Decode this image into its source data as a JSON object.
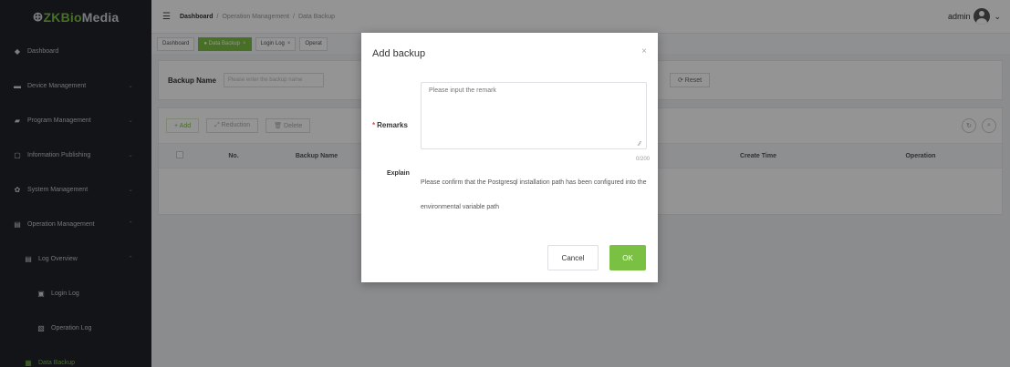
{
  "logo": {
    "mark": "⊕",
    "brand": "ZKBio",
    "suffix": "Media"
  },
  "sidebar": {
    "items": [
      {
        "label": "Dashboard",
        "icon": "dashboard-icon",
        "glyph": "◆"
      },
      {
        "label": "Device Management",
        "icon": "device-icon",
        "glyph": "▬",
        "chevron": "⌄"
      },
      {
        "label": "Program Management",
        "icon": "program-icon",
        "glyph": "▰",
        "chevron": "⌄"
      },
      {
        "label": "Information Publishing",
        "icon": "publish-icon",
        "glyph": "▢",
        "chevron": "⌄"
      },
      {
        "label": "System Management",
        "icon": "system-gear-icon",
        "glyph": "✿",
        "chevron": "⌄"
      },
      {
        "label": "Operation Management",
        "icon": "operation-icon",
        "glyph": "▤",
        "chevron": "⌃"
      },
      {
        "label": "Log Overview",
        "icon": "log-overview-icon",
        "glyph": "▤",
        "chevron": "⌃"
      },
      {
        "label": "Login Log",
        "icon": "login-log-icon",
        "glyph": "▣"
      },
      {
        "label": "Operation Log",
        "icon": "operation-log-icon",
        "glyph": "▧"
      },
      {
        "label": "Data Backup",
        "icon": "data-backup-icon",
        "glyph": "▦"
      }
    ]
  },
  "header": {
    "menu_glyph": "☰",
    "breadcrumb": [
      "Dashboard",
      "/",
      "Operation Management",
      "/",
      "Data Backup"
    ],
    "user": "admin",
    "chevron": "⌄"
  },
  "tabs": [
    {
      "label": "Dashboard"
    },
    {
      "label": "● Data Backup",
      "close": "×"
    },
    {
      "label": "Login Log",
      "close": "×"
    },
    {
      "label": "Operat"
    }
  ],
  "search": {
    "label": "Backup Name",
    "placeholder": "Please enter the backup name",
    "reset": "⟳ Reset"
  },
  "toolbar": {
    "add": "+ Add",
    "reduction": "⤢ Reduction",
    "delete": "🗑 Delete",
    "refresh_glyph": "↻",
    "search_glyph": "⌕"
  },
  "table": {
    "columns": [
      "No.",
      "Backup Name",
      "Create Time",
      "Operation"
    ]
  },
  "modal": {
    "title": "Add backup",
    "close": "×",
    "remarks_required": "*",
    "remarks_label": "Remarks",
    "remarks_placeholder": "Please input the remark",
    "resize_glyph": "⁄⁄",
    "counter": "0/200",
    "explain_label": "Explain",
    "explain_text": "Please confirm that the Postgresql installation path has been configured into the environmental variable path",
    "cancel": "Cancel",
    "ok": "OK"
  },
  "colors": {
    "accent": "#7ac143",
    "sidebar_bg": "#20232a",
    "required": "#e94b3c"
  }
}
